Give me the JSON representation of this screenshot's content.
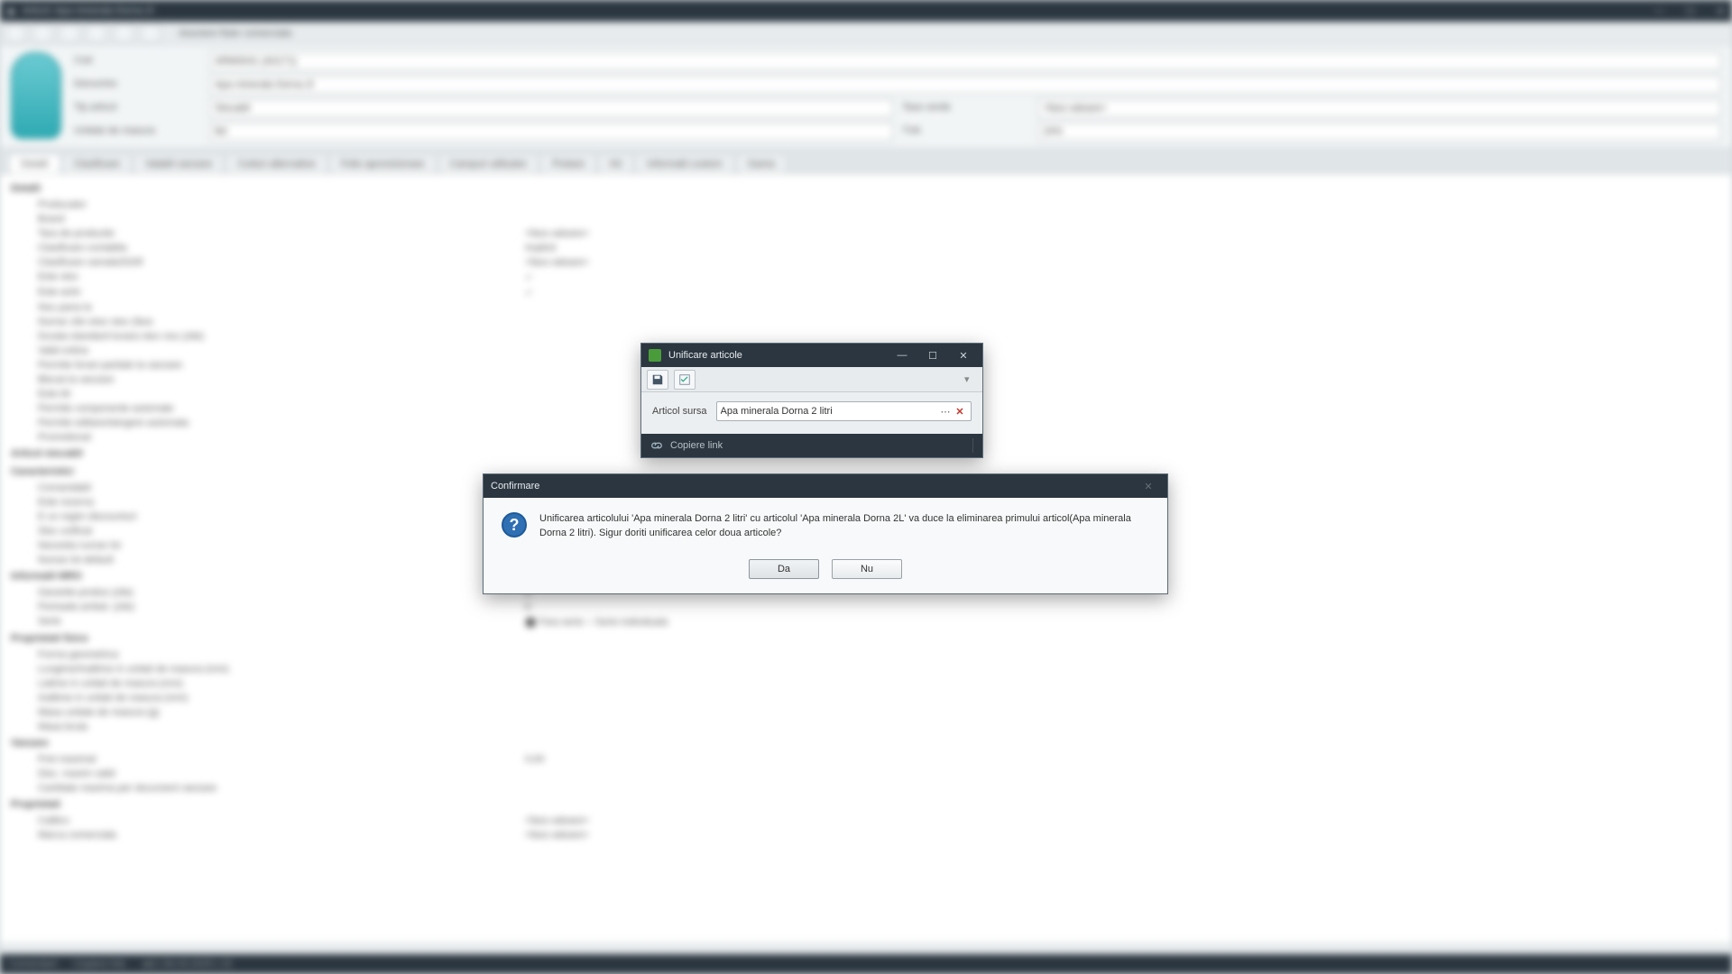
{
  "window": {
    "title": "Articol: Apa minerala Dorna 2l"
  },
  "toolbar": {
    "breadcrumb": "Asociere fisier comerciala"
  },
  "form": {
    "cod_label": "Cod",
    "cod_value": "ARM0041 (A0171)",
    "denumire_label": "Denumire",
    "denumire_value": "Apa minerala Dorna 2l",
    "tip_articol_label": "Tip articol",
    "tip_articol_value": "Stocabil",
    "um_label": "Unitate de masura",
    "um_value": "litri",
    "taxe_label": "Taxe verde",
    "taxe_value": "<fara valoare>",
    "tva_label": "TVA",
    "tva_value": "24%"
  },
  "tabs": [
    "Detalii",
    "Clasificare",
    "Valabil vanzare",
    "Coduri alternative",
    "Folio aprovizionare",
    "Campuri utilizator",
    "Pretare",
    "Kit",
    "Informatii custom",
    "Gama"
  ],
  "details": {
    "sections": [
      {
        "title": "Detalii",
        "rows": [
          {
            "k": "Producator",
            "v": ""
          },
          {
            "k": "Brand",
            "v": ""
          },
          {
            "k": "Tara de productie",
            "v": "<fara valoare>"
          },
          {
            "k": "Clasificare contabila",
            "v": "Implicit"
          },
          {
            "k": "Clasificare vamala/SGR",
            "v": "<fara valoare>"
          },
          {
            "k": "Este stoc",
            "v": "✓"
          },
          {
            "k": "Este activ",
            "v": "✓"
          },
          {
            "k": "Nou pana la",
            "v": ""
          },
          {
            "k": "Numar zile retur stoc (fara",
            "v": ""
          },
          {
            "k": "Durata standard lunara stoc nou (zile)",
            "v": ""
          },
          {
            "k": "Valid online",
            "v": ""
          },
          {
            "k": "Permite livrari partiale la vanzare",
            "v": ""
          },
          {
            "k": "Blocat la vanzare",
            "v": ""
          },
          {
            "k": "Este kit",
            "v": ""
          },
          {
            "k": "Permite componente automate",
            "v": ""
          },
          {
            "k": "Permite editare/stergere automata",
            "v": ""
          },
          {
            "k": "Promotional",
            "v": ""
          }
        ]
      },
      {
        "title": "Articol stocabil",
        "rows": []
      },
      {
        "title": "Caracteristici",
        "rows": [
          {
            "k": "Comandabil",
            "v": ""
          },
          {
            "k": "Este rezerva",
            "v": ""
          },
          {
            "k": "E un regim discounturi",
            "v": ""
          },
          {
            "k": "Stoc unificat",
            "v": ""
          },
          {
            "k": "Necesita numar lot",
            "v": ""
          },
          {
            "k": "Numar lot default",
            "v": ""
          }
        ]
      },
      {
        "title": "Informatii MRO",
        "rows": [
          {
            "k": "Garantie produs (zile)",
            "v": "0"
          },
          {
            "k": "Perioada ambal. (zile)",
            "v": "0"
          },
          {
            "k": "Serie",
            "v": "⬤ Fara serie        ○ Serie individuala"
          }
        ]
      },
      {
        "title": "Proprietati fizice",
        "rows": [
          {
            "k": "Forma geometrica",
            "v": ""
          },
          {
            "k": "Lungime/Inaltime in unitati de masura (mm)",
            "v": ""
          },
          {
            "k": "Latime in unitati de masura (mm)",
            "v": ""
          },
          {
            "k": "Inaltime in unitati de masura (mm)",
            "v": ""
          },
          {
            "k": "Masa unitate de masura (g)",
            "v": ""
          },
          {
            "k": "Masa bruta",
            "v": ""
          }
        ]
      },
      {
        "title": "Vanzare",
        "rows": [
          {
            "k": "Pret maximal",
            "v": "0,00"
          },
          {
            "k": "Disc. maxim valid",
            "v": ""
          },
          {
            "k": "Cantitate maxima per document vanzare",
            "v": ""
          }
        ]
      },
      {
        "title": "Proprietati",
        "rows": [
          {
            "k": "Calibru",
            "v": "<fara valoare>"
          },
          {
            "k": "Marca comerciala",
            "v": "<fara valoare>"
          }
        ]
      }
    ]
  },
  "statusbar": {
    "left": "Comentarii",
    "link": "Copiere link",
    "meta": "adi | 06.03.2025 | 15"
  },
  "dialog_unif": {
    "title": "Unificare articole",
    "field_label": "Articol sursa",
    "field_value": "Apa minerala Dorna 2 litri",
    "footer_link": "Copiere link"
  },
  "dialog_confirm": {
    "title": "Confirmare",
    "message": "Unificarea articolului 'Apa minerala Dorna 2 litri' cu articolul 'Apa minerala Dorna 2L' va duce la eliminarea primului articol(Apa minerala Dorna 2 litri). Sigur doriti unificarea celor doua articole?",
    "yes": "Da",
    "no": "Nu"
  }
}
